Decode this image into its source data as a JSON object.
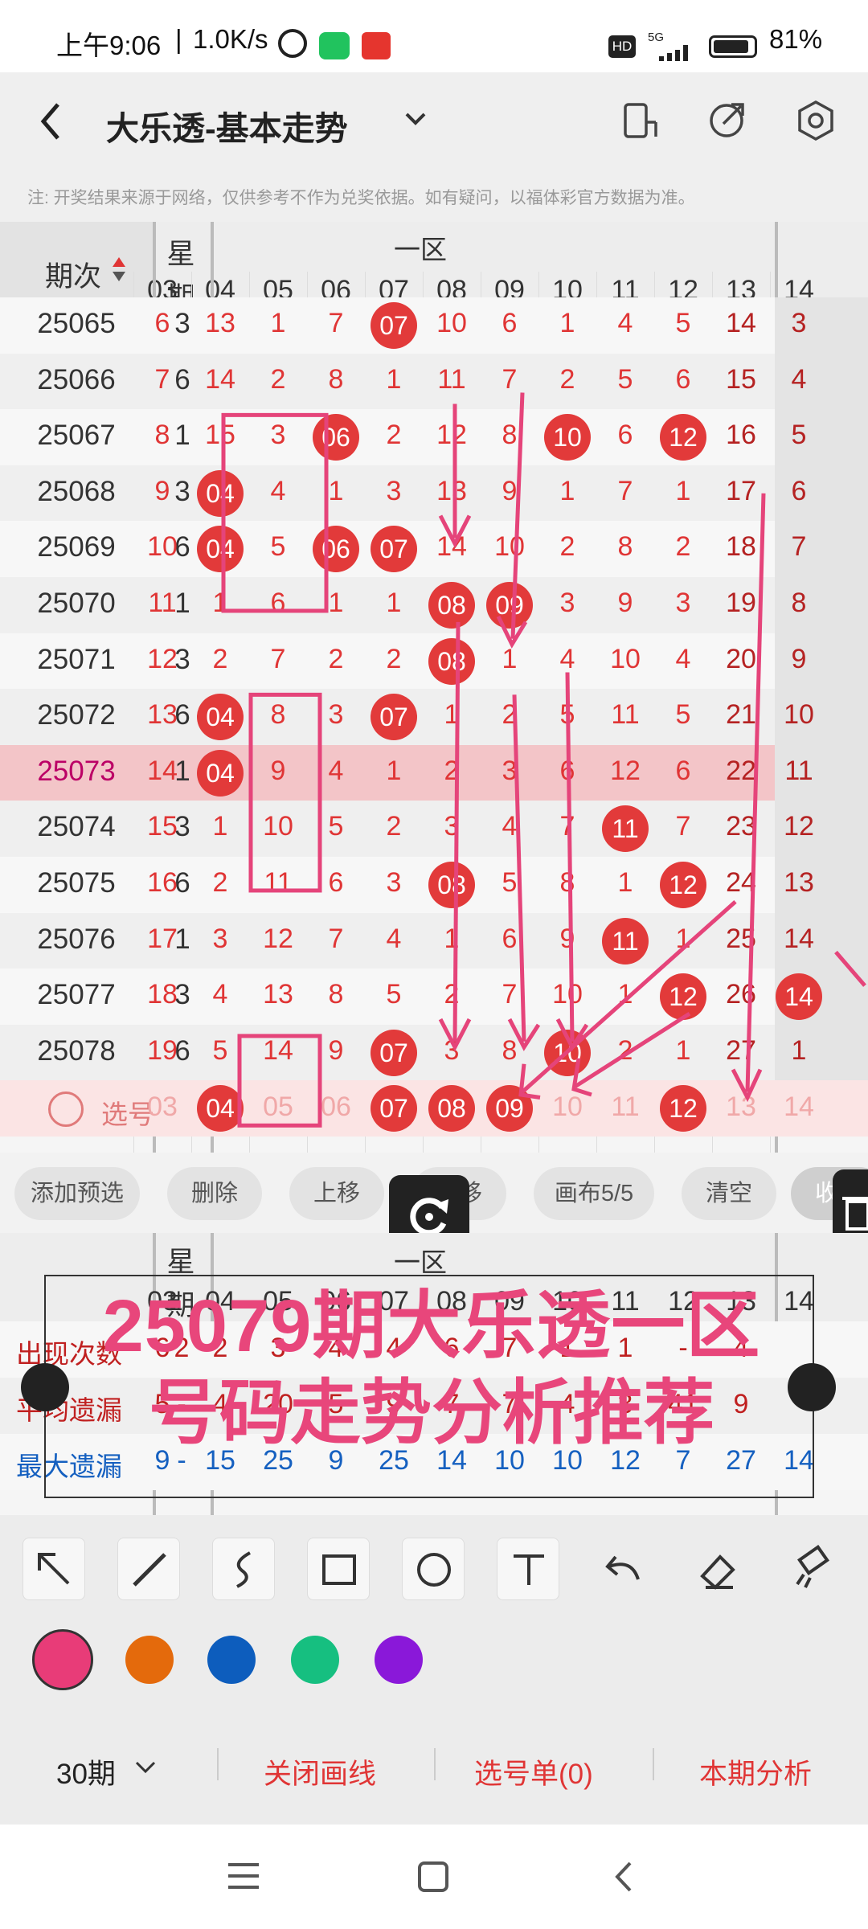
{
  "status": {
    "time": "上午9:06",
    "speed": "1.0K/s",
    "net": "5G",
    "hd": "HD",
    "battery": "81%"
  },
  "header": {
    "title": "大乐透-基本走势"
  },
  "note": "注: 开奖结果来源于网络，仅供参考不作为兑奖依据。如有疑问，以福体彩官方数据为准。",
  "table": {
    "issue_header": "期次",
    "week_header": "星期",
    "zone_header": "一区",
    "columns": [
      "03",
      "04",
      "05",
      "06",
      "07",
      "08",
      "09",
      "10",
      "11",
      "12",
      "13",
      "14"
    ],
    "rows": [
      {
        "issue": "25065",
        "week": "3",
        "cells": [
          "6",
          "13",
          "1",
          "7",
          "07",
          "10",
          "6",
          "1",
          "4",
          "5",
          "14",
          "3"
        ],
        "balls": [
          4
        ]
      },
      {
        "issue": "25066",
        "week": "6",
        "cells": [
          "7",
          "14",
          "2",
          "8",
          "1",
          "11",
          "7",
          "2",
          "5",
          "6",
          "15",
          "4"
        ],
        "balls": []
      },
      {
        "issue": "25067",
        "week": "1",
        "cells": [
          "8",
          "15",
          "3",
          "06",
          "2",
          "12",
          "8",
          "10",
          "6",
          "12",
          "16",
          "5"
        ],
        "balls": [
          3,
          7,
          9
        ]
      },
      {
        "issue": "25068",
        "week": "3",
        "cells": [
          "9",
          "04",
          "4",
          "1",
          "3",
          "13",
          "9",
          "1",
          "7",
          "1",
          "17",
          "6"
        ],
        "balls": [
          1
        ]
      },
      {
        "issue": "25069",
        "week": "6",
        "cells": [
          "10",
          "04",
          "5",
          "06",
          "07",
          "14",
          "10",
          "2",
          "8",
          "2",
          "18",
          "7"
        ],
        "balls": [
          1,
          3,
          4
        ]
      },
      {
        "issue": "25070",
        "week": "1",
        "cells": [
          "11",
          "1",
          "6",
          "1",
          "1",
          "08",
          "09",
          "3",
          "9",
          "3",
          "19",
          "8"
        ],
        "balls": [
          5,
          6
        ]
      },
      {
        "issue": "25071",
        "week": "3",
        "cells": [
          "12",
          "2",
          "7",
          "2",
          "2",
          "08",
          "1",
          "4",
          "10",
          "4",
          "20",
          "9"
        ],
        "balls": [
          5
        ]
      },
      {
        "issue": "25072",
        "week": "6",
        "cells": [
          "13",
          "04",
          "8",
          "3",
          "07",
          "1",
          "2",
          "5",
          "11",
          "5",
          "21",
          "10"
        ],
        "balls": [
          1,
          4
        ]
      },
      {
        "issue": "25073",
        "week": "1",
        "cells": [
          "14",
          "04",
          "9",
          "4",
          "1",
          "2",
          "3",
          "6",
          "12",
          "6",
          "22",
          "11"
        ],
        "balls": [
          1
        ]
      },
      {
        "issue": "25074",
        "week": "3",
        "cells": [
          "15",
          "1",
          "10",
          "5",
          "2",
          "3",
          "4",
          "7",
          "11",
          "7",
          "23",
          "12"
        ],
        "balls": [
          8
        ]
      },
      {
        "issue": "25075",
        "week": "6",
        "cells": [
          "16",
          "2",
          "11",
          "6",
          "3",
          "08",
          "5",
          "8",
          "1",
          "12",
          "24",
          "13"
        ],
        "balls": [
          5,
          9
        ]
      },
      {
        "issue": "25076",
        "week": "1",
        "cells": [
          "17",
          "3",
          "12",
          "7",
          "4",
          "1",
          "6",
          "9",
          "11",
          "1",
          "25",
          "14"
        ],
        "balls": [
          8
        ]
      },
      {
        "issue": "25077",
        "week": "3",
        "cells": [
          "18",
          "4",
          "13",
          "8",
          "5",
          "2",
          "7",
          "10",
          "1",
          "12",
          "26",
          "14"
        ],
        "balls": [
          9,
          11
        ]
      },
      {
        "issue": "25078",
        "week": "6",
        "cells": [
          "19",
          "5",
          "14",
          "9",
          "07",
          "3",
          "8",
          "10",
          "2",
          "1",
          "27",
          "1"
        ],
        "balls": [
          4,
          7
        ]
      }
    ],
    "select_label": "选号",
    "select_row": [
      "03",
      "04",
      "05",
      "06",
      "07",
      "08",
      "09",
      "10",
      "11",
      "12",
      "13",
      "14"
    ],
    "select_balls": [
      1,
      4,
      5,
      6,
      9
    ]
  },
  "buttons": [
    "添加预选",
    "删除",
    "上移",
    "下移",
    "画布5/5",
    "清空",
    "收起"
  ],
  "stats": {
    "zone_header": "一区",
    "columns": [
      "03",
      "04",
      "05",
      "06",
      "07",
      "08",
      "09",
      "10",
      "11",
      "12",
      "13",
      "14"
    ],
    "rows": [
      {
        "label": "出现次数",
        "values": [
          "2",
          "6",
          "2",
          "3",
          "4",
          "4",
          "6",
          "7",
          "1",
          "1",
          "-",
          "4"
        ]
      },
      {
        "label": "平均遗漏",
        "values": [
          "-",
          "5",
          "4",
          "20",
          "5",
          "9",
          "7",
          "7",
          "4",
          "3",
          "41",
          "9"
        ]
      },
      {
        "label": "最大遗漏",
        "values": [
          "-",
          "9",
          "15",
          "25",
          "9",
          "25",
          "14",
          "10",
          "10",
          "12",
          "7",
          "27",
          "14"
        ]
      }
    ]
  },
  "overlay_text": {
    "line1": "25079期大乐透一区",
    "line2": "号码走势分析推荐"
  },
  "colors": {
    "pink": "#e83c78",
    "orange": "#e46a0c",
    "blue": "#0d5dbd",
    "green": "#16bf80",
    "purple": "#8a18d9",
    "ball": "#e23a3a"
  },
  "bottom": {
    "period": "30期",
    "close": "关闭画线",
    "pick": "选号单(0)",
    "analysis": "本期分析"
  }
}
